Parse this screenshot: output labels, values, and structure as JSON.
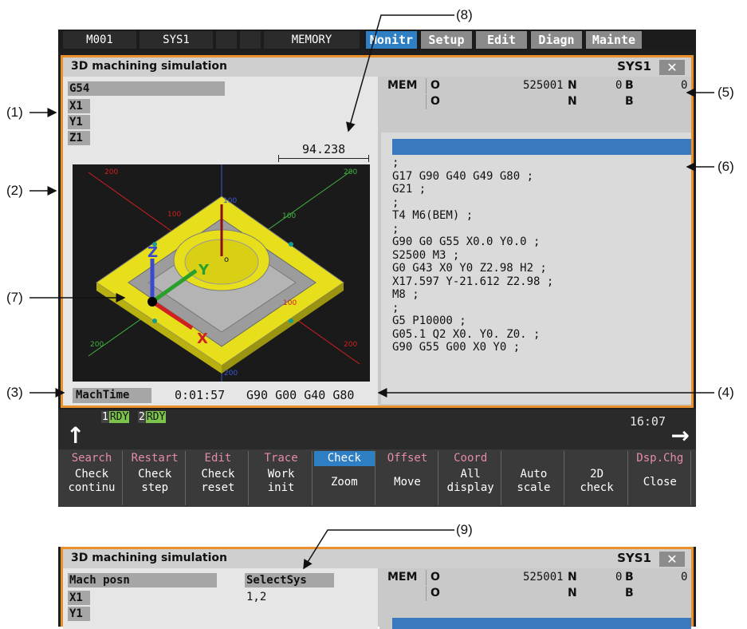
{
  "topbar": {
    "program": "M001",
    "system": "SYS1",
    "mode": "MEMORY",
    "tabs": [
      "Monitr",
      "Setup",
      "Edit",
      "Diagn",
      "Mainte"
    ],
    "active_tab": "Monitr"
  },
  "window": {
    "title": "3D machining simulation",
    "sys": "SYS1",
    "close": "✕"
  },
  "left": {
    "wcs": "G54",
    "axes": [
      "X1",
      "Y1",
      "Z1"
    ],
    "scale_value": "94.238",
    "mach_time_label": "MachTime",
    "mach_time": "0:01:57",
    "modal": "G90 G00 G40 G80"
  },
  "viewport": {
    "tick_200": "200",
    "tick_100": "100",
    "axis_x": "X",
    "axis_y": "Y",
    "axis_z": "Z",
    "origin": "o"
  },
  "right": {
    "row1": {
      "mode": "MEM",
      "o_label": "O",
      "o_val": "525001",
      "n_label": "N",
      "n_val": "0",
      "b_label": "B",
      "b_val": "0"
    },
    "row2": {
      "o_label": "O",
      "n_label": "N",
      "b_label": "B"
    },
    "code": [
      ";",
      "G17 G90 G40 G49 G80 ;",
      "G21 ;",
      ";",
      "T4 M6(BEM) ;",
      ";",
      "G90 G0 G55 X0.0 Y0.0 ;",
      "S2500 M3 ;",
      "G0 G43 X0 Y0 Z2.98 H2 ;",
      "X17.597 Y-21.612 Z2.98 ;",
      "M8 ;",
      ";",
      "G5 P10000 ;",
      "G05.1 Q2 X0. Y0. Z0. ;",
      "G90 G55 G00 X0 Y0 ;"
    ]
  },
  "status": {
    "sys1": "1",
    "sys2": "2",
    "rdy": "RDY",
    "clock": "16:07",
    "back_icon": "↑",
    "next_icon": "→"
  },
  "fkeys": [
    {
      "menu": "Search",
      "sub1": "Check",
      "sub2": "continu"
    },
    {
      "menu": "Restart",
      "sub1": "Check",
      "sub2": "step"
    },
    {
      "menu": "Edit",
      "sub1": "Check",
      "sub2": "reset"
    },
    {
      "menu": "Trace",
      "sub1": "Work",
      "sub2": "init"
    },
    {
      "menu": "Check",
      "sub1": "Zoom",
      "sub2": ""
    },
    {
      "menu": "Offset",
      "sub1": "Move",
      "sub2": ""
    },
    {
      "menu": "Coord",
      "sub1": "All",
      "sub2": "display"
    },
    {
      "menu": "",
      "sub1": "Auto",
      "sub2": "scale"
    },
    {
      "menu": "",
      "sub1": "2D",
      "sub2": "check"
    },
    {
      "menu": "Dsp.Chg",
      "sub1": "Close",
      "sub2": ""
    }
  ],
  "window2": {
    "title": "3D machining simulation",
    "sys": "SYS1",
    "close": "✕",
    "mach_posn": "Mach posn",
    "select_sys": "SelectSys",
    "select_sys_val": "1,2",
    "axes": [
      "X1",
      "Y1"
    ],
    "row1": {
      "mode": "MEM",
      "o_label": "O",
      "o_val": "525001",
      "n_label": "N",
      "n_val": "0",
      "b_label": "B",
      "b_val": "0"
    },
    "row2": {
      "o_label": "O",
      "n_label": "N",
      "b_label": "B"
    }
  },
  "callouts": [
    "(1)",
    "(2)",
    "(3)",
    "(4)",
    "(5)",
    "(6)",
    "(7)",
    "(8)",
    "(9)"
  ]
}
